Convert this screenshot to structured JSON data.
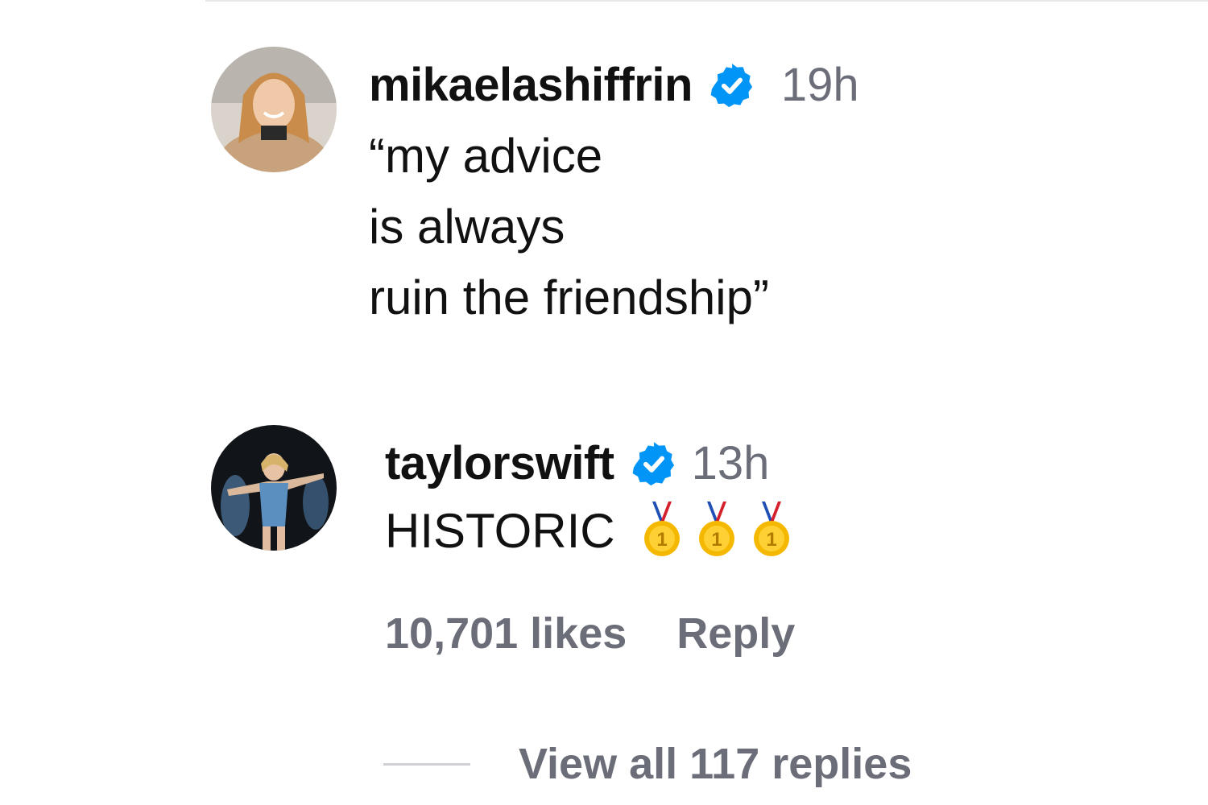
{
  "comments": [
    {
      "username": "mikaelashiffrin",
      "verified_icon": "verified-badge-icon",
      "time": "19h",
      "text_lines": [
        "“my advice",
        "is always",
        "ruin the friendship”"
      ],
      "avatar_icon": "profile-photo-avatar"
    },
    {
      "username": "taylorswift",
      "verified_icon": "verified-badge-icon",
      "time": "13h",
      "text": "HISTORIC",
      "emojis": [
        "gold-medal-icon",
        "gold-medal-icon",
        "gold-medal-icon"
      ],
      "avatar_icon": "profile-photo-avatar",
      "likes": "10,701 likes",
      "reply_label": "Reply",
      "view_replies": "View all 117 replies"
    }
  ],
  "colors": {
    "verified": "#0095f6",
    "secondary_text": "#6b6e78",
    "primary_text": "#111111"
  }
}
